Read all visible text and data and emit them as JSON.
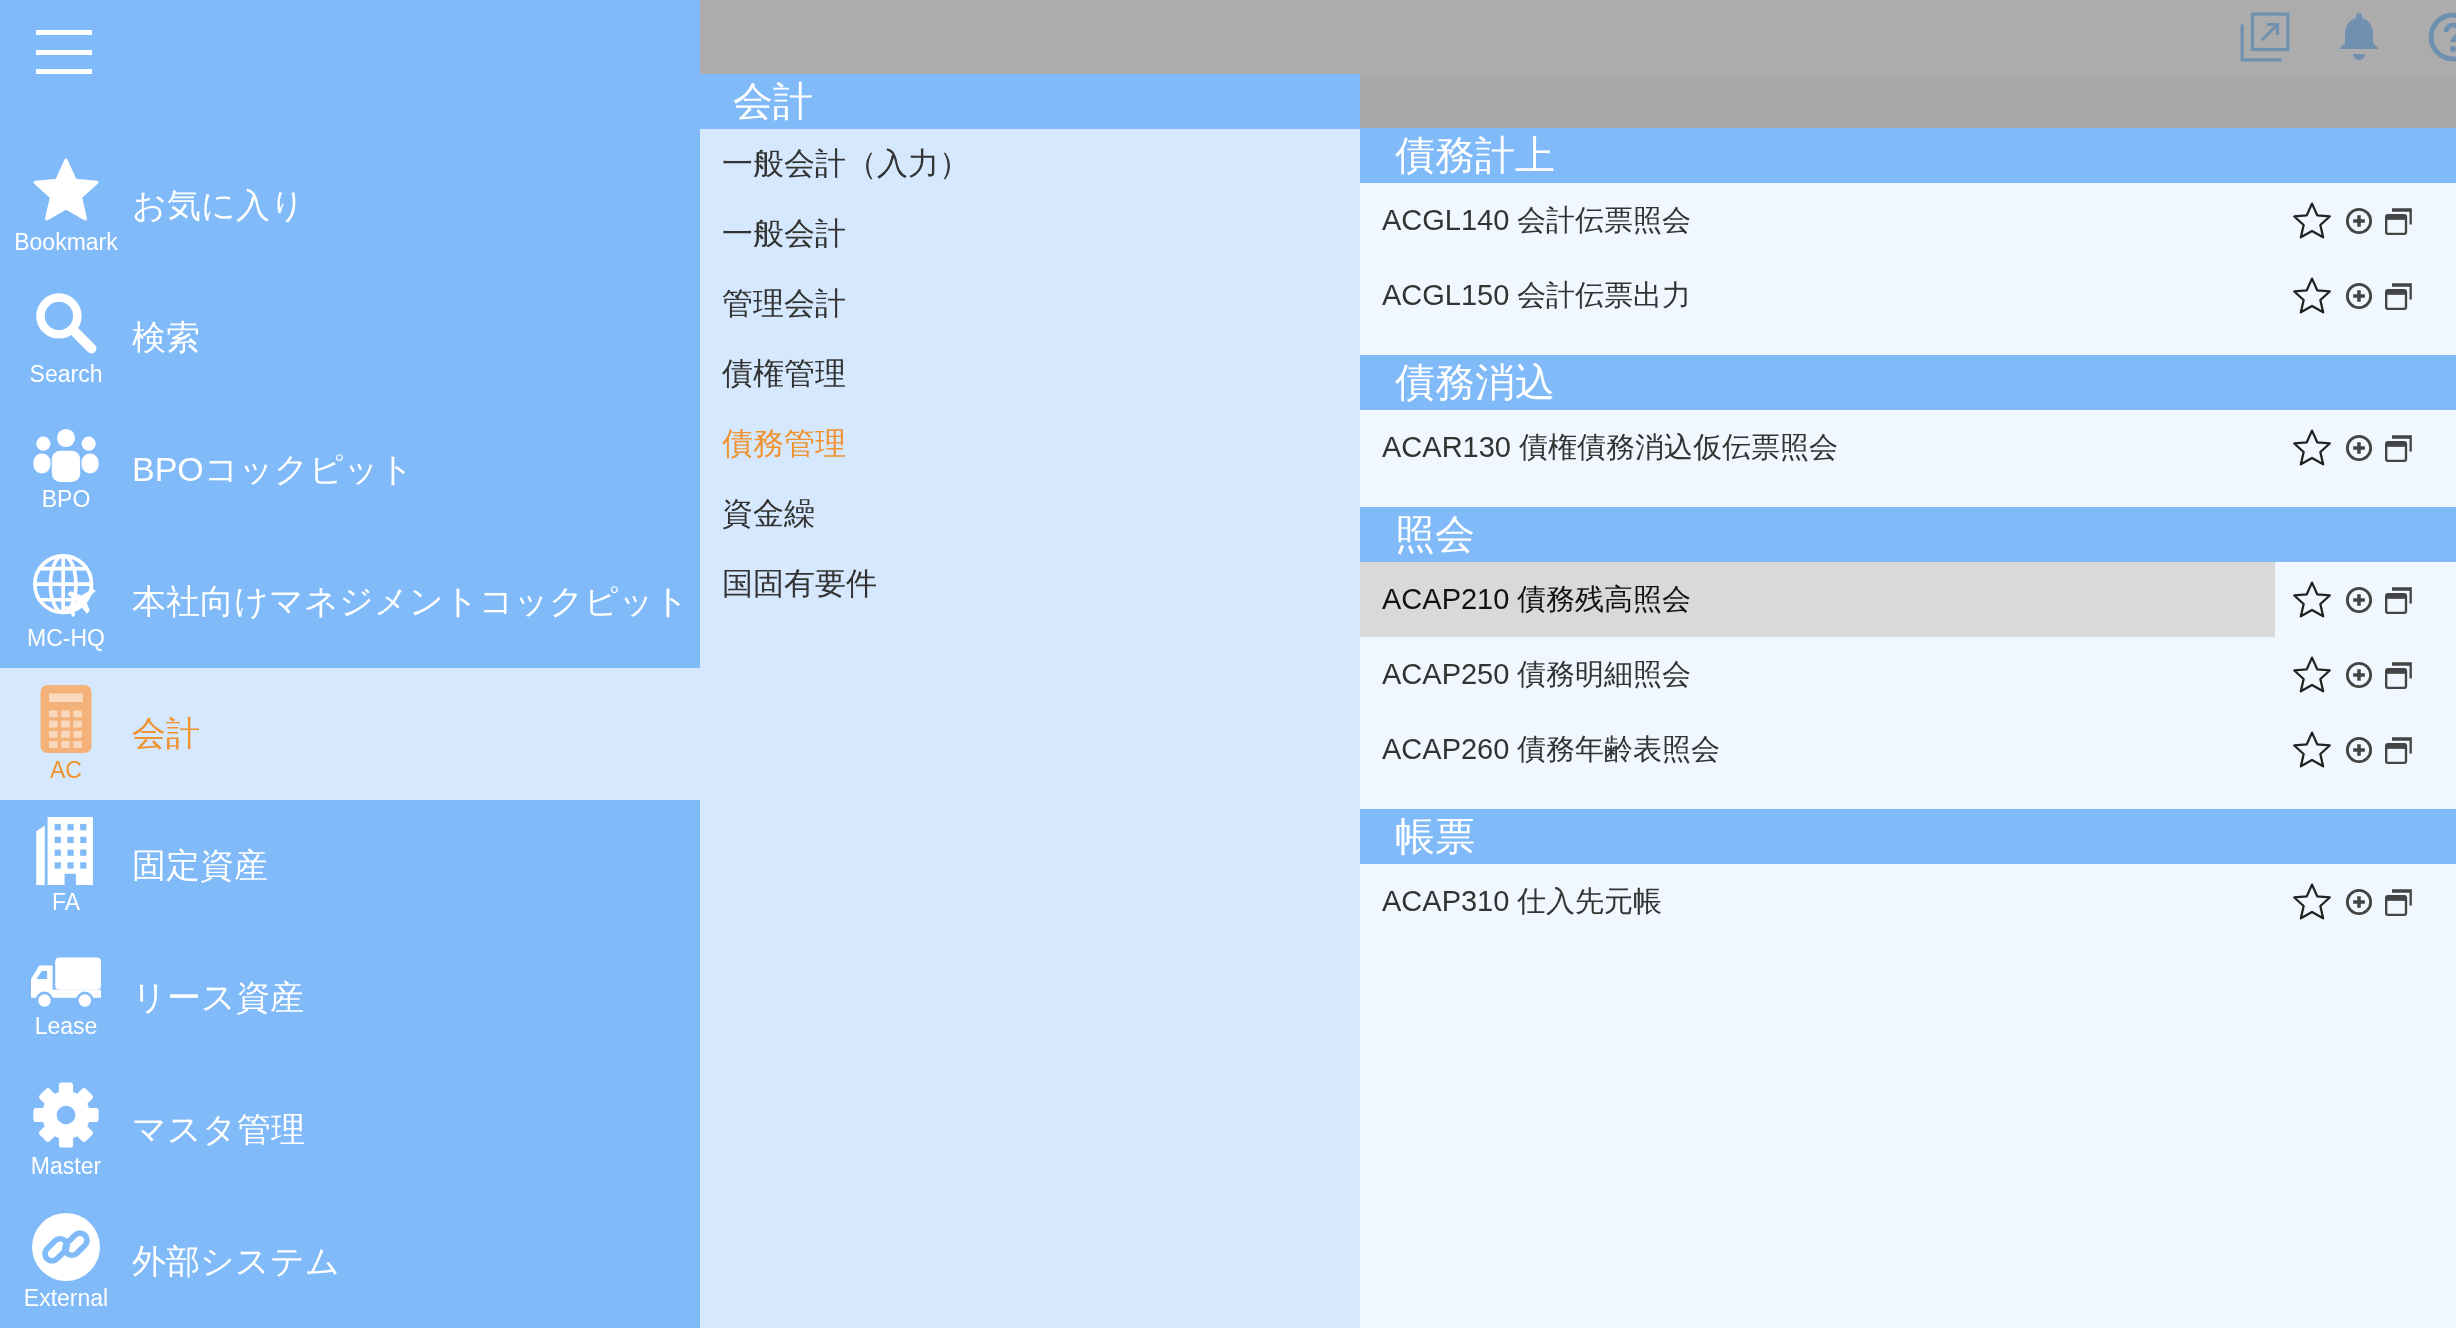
{
  "sidebar": {
    "items": [
      {
        "label": "お気に入り",
        "caption": "Bookmark",
        "selected": false
      },
      {
        "label": "検索",
        "caption": "Search",
        "selected": false
      },
      {
        "label": "BPOコックピット",
        "caption": "BPO",
        "selected": false
      },
      {
        "label": "本社向けマネジメントコックピット",
        "caption": "MC-HQ",
        "selected": false
      },
      {
        "label": "会計",
        "caption": "AC",
        "selected": true
      },
      {
        "label": "固定資産",
        "caption": "FA",
        "selected": false
      },
      {
        "label": "リース資産",
        "caption": "Lease",
        "selected": false
      },
      {
        "label": "マスタ管理",
        "caption": "Master",
        "selected": false
      },
      {
        "label": "外部システム",
        "caption": "External",
        "selected": false
      }
    ]
  },
  "submenu": {
    "title": "会計",
    "items": [
      {
        "label": "一般会計（入力）",
        "selected": false
      },
      {
        "label": "一般会計",
        "selected": false
      },
      {
        "label": "管理会計",
        "selected": false
      },
      {
        "label": "債権管理",
        "selected": false
      },
      {
        "label": "債務管理",
        "selected": true
      },
      {
        "label": "資金繰",
        "selected": false
      },
      {
        "label": "国固有要件",
        "selected": false
      }
    ]
  },
  "sections": [
    {
      "title": "債務計上",
      "rows": [
        {
          "label": "ACGL140 会計伝票照会",
          "selected": false
        },
        {
          "label": "ACGL150 会計伝票出力",
          "selected": false
        }
      ]
    },
    {
      "title": "債務消込",
      "rows": [
        {
          "label": "ACAR130 債権債務消込仮伝票照会",
          "selected": false
        }
      ]
    },
    {
      "title": "照会",
      "rows": [
        {
          "label": "ACAP210 債務残高照会",
          "selected": true
        },
        {
          "label": "ACAP250 債務明細照会",
          "selected": false
        },
        {
          "label": "ACAP260 債務年齢表照会",
          "selected": false
        }
      ]
    },
    {
      "title": "帳票",
      "rows": [
        {
          "label": "ACAP310 仕入先元帳",
          "selected": false
        }
      ]
    }
  ]
}
